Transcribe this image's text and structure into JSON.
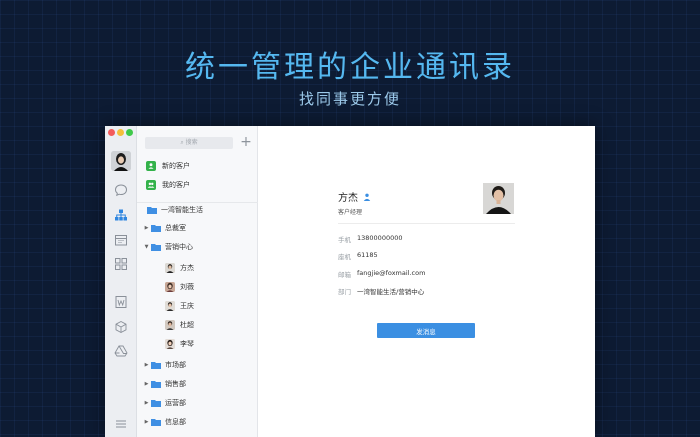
{
  "hero": {
    "title": "统一管理的企业通讯录",
    "subtitle": "找同事更方便"
  },
  "rail": {
    "icons": [
      "chat-icon",
      "contacts-icon",
      "calendar-icon",
      "apps-icon",
      "word-doc-icon",
      "package-icon",
      "drive-icon",
      "menu-icon"
    ],
    "active": "contacts-icon"
  },
  "list": {
    "search_placeholder": "搜索",
    "add_symbol": "+",
    "quick_items": [
      {
        "label": "新的客户",
        "icon": "new-customer-icon"
      },
      {
        "label": "我的客户",
        "icon": "my-customer-icon"
      }
    ],
    "company": "一湾智能生活",
    "depts_top": [
      {
        "label": "总裁室"
      },
      {
        "label": "营销中心",
        "expanded": true
      }
    ],
    "members": [
      {
        "label": "方杰"
      },
      {
        "label": "刘薇"
      },
      {
        "label": "王庆"
      },
      {
        "label": "杜超"
      },
      {
        "label": "李琴"
      }
    ],
    "depts_bottom": [
      {
        "label": "市场部"
      },
      {
        "label": "销售部"
      },
      {
        "label": "运营部"
      },
      {
        "label": "信息部"
      }
    ]
  },
  "profile": {
    "name": "方杰",
    "role": "客户经理",
    "fields": [
      {
        "key": "手机",
        "value": "13800000000"
      },
      {
        "key": "座机",
        "value": "61185"
      },
      {
        "key": "邮箱",
        "value": "fangjie@foxmail.com"
      },
      {
        "key": "部门",
        "value": "一湾智能生活/营销中心"
      }
    ],
    "send_label": "发消息"
  },
  "colors": {
    "accent": "#3b8fe2",
    "hero_title": "#55b8f0",
    "folder": "#3f8fe3",
    "badge_green": "#33b24a",
    "background": "#0d1b33"
  }
}
